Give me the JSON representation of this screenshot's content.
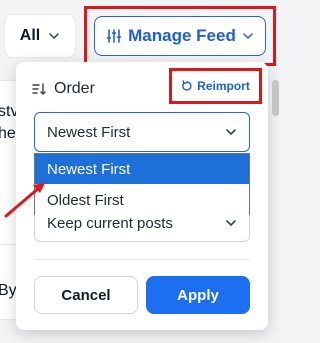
{
  "background": {
    "text_1": "stv",
    "text_2": "he",
    "text_3": "By"
  },
  "toolbar": {
    "filter_label": "All",
    "manage_feed_label": "Manage Feed"
  },
  "panel": {
    "order_label": "Order",
    "reimport_label": "Reimport",
    "order_select_value": "Newest First",
    "order_options": [
      "Newest First",
      "Oldest First"
    ],
    "posts_select_value": "Keep current posts",
    "cancel_label": "Cancel",
    "apply_label": "Apply"
  },
  "colors": {
    "accent": "#1d6ff2",
    "highlight_box": "#e0161b",
    "selected_option": "#1f6fd8"
  },
  "icons": {
    "filter": "chevron-down-icon",
    "manage": "sliders-icon",
    "order": "sort-icon",
    "reimport": "refresh-icon"
  }
}
